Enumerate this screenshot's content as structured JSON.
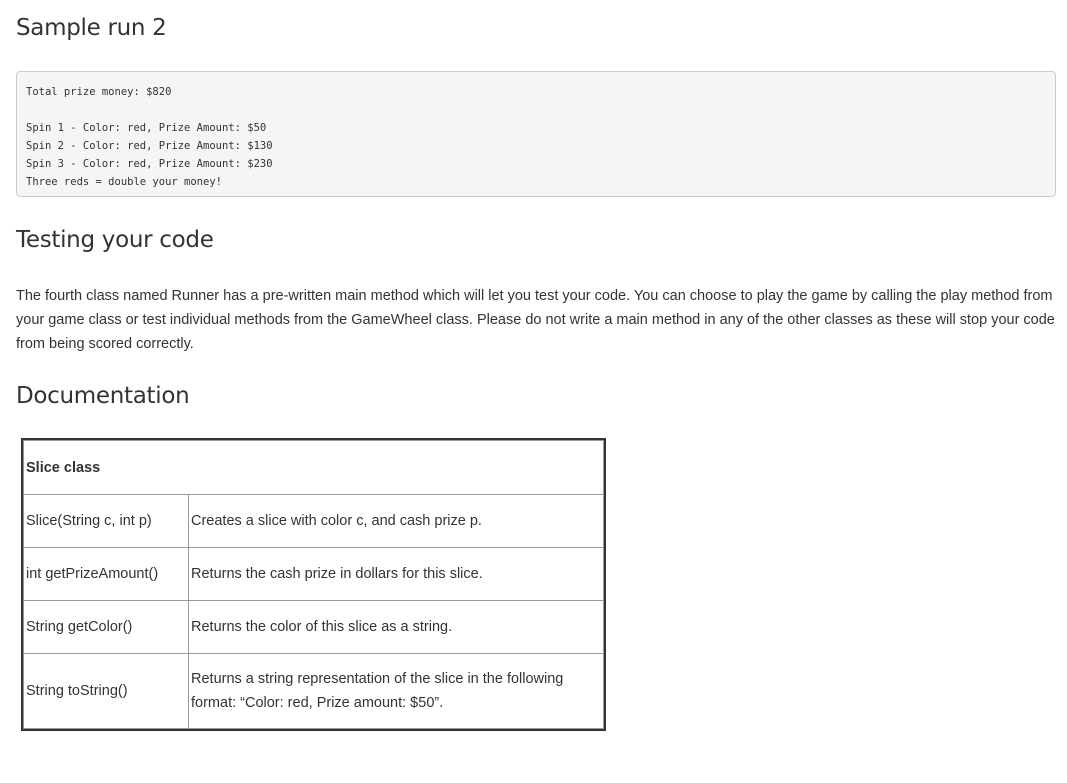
{
  "sample_run": {
    "heading": "Sample run 2",
    "output_lines": [
      "Total prize money: $820",
      "",
      "Spin 1 - Color: red, Prize Amount: $50",
      "Spin 2 - Color: red, Prize Amount: $130",
      "Spin 3 - Color: red, Prize Amount: $230",
      "Three reds = double your money!"
    ]
  },
  "testing": {
    "heading": "Testing your code",
    "paragraph": "The fourth class named Runner has a pre-written main method which will let you test your code. You can choose to play the game by calling the play method from your game class or test individual methods from the GameWheel class. Please do not write a main method in any of the other classes as these will stop your code from being scored correctly."
  },
  "documentation": {
    "heading": "Documentation",
    "table_title": "Slice class",
    "rows": [
      {
        "signature": "Slice(String c, int p)",
        "description": "Creates a slice with color c, and cash prize p."
      },
      {
        "signature": "int getPrizeAmount()",
        "description": "Returns the cash prize in dollars for this slice."
      },
      {
        "signature": "String getColor()",
        "description": "Returns the color of this slice as a string."
      },
      {
        "signature": "String toString()",
        "description": "Returns a string representation of the slice in the following format: “Color: red, Prize amount: $50”."
      }
    ]
  }
}
